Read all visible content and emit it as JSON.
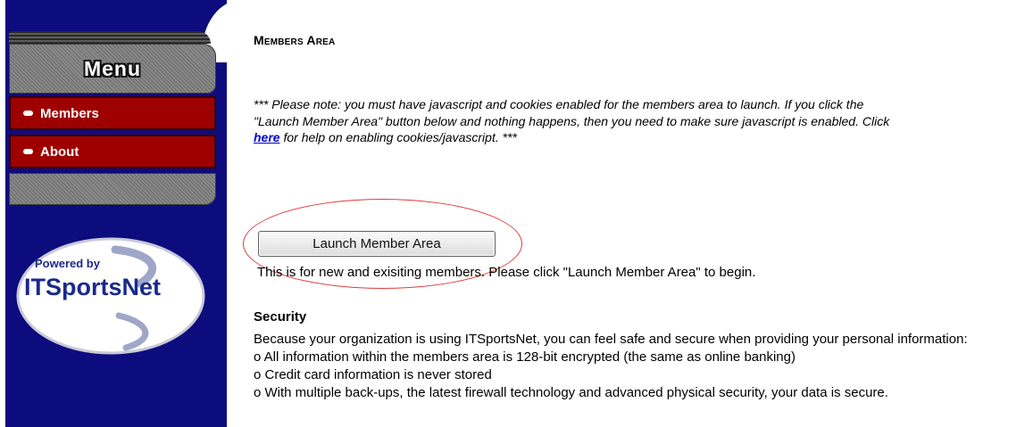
{
  "sidebar": {
    "menu_title": "Menu",
    "items": [
      {
        "label": "Members"
      },
      {
        "label": "About"
      }
    ],
    "logo": {
      "powered_by": "Powered by",
      "brand": "ITSportsNet"
    }
  },
  "main": {
    "title": "Members Area",
    "note": {
      "before_link": "*** Please note: you must have javascript and cookies enabled for the members area to launch. If you click the \"Launch Member Area\" button below and nothing happens, then you need to make sure javascript is enabled. Click ",
      "link": "here",
      "after_link": " for help on enabling cookies/javascript. ***"
    },
    "launch_button": "Launch Member Area",
    "launch_description": "This is for new and exisiting members. Please click \"Launch Member Area\" to begin.",
    "security": {
      "heading": "Security",
      "intro": "Because your organization is using ITSportsNet, you can feel safe and secure when providing your personal information:",
      "points": [
        "o All information within the members area is 128-bit encrypted (the same as online banking)",
        "o Credit card information is never stored",
        "o With multiple back-ups, the latest firewall technology and advanced physical security, your data is secure."
      ]
    }
  },
  "colors": {
    "sidebar_bg": "#0c0c7e",
    "nav_item_bg": "#9e0000",
    "link": "#0000cc",
    "highlight_ring": "#e23a3a"
  }
}
